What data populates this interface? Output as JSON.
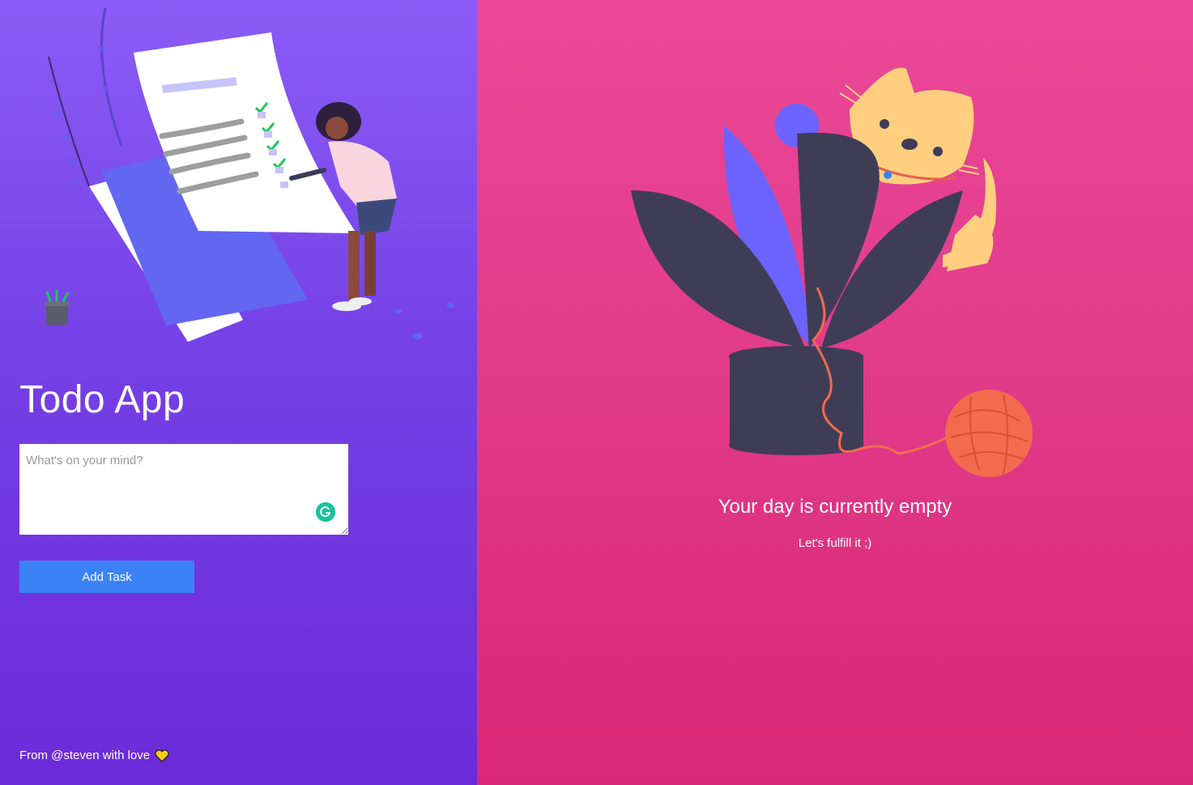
{
  "app": {
    "title": "Todo App"
  },
  "form": {
    "placeholder": "What's on your mind?",
    "value": "",
    "add_button_label": "Add Task"
  },
  "footer": {
    "text": "From @steven with love"
  },
  "empty_state": {
    "title": "Your day is currently empty",
    "subtitle": "Let's fulfill it ;)"
  },
  "colors": {
    "left_panel": "#7c3aed",
    "right_panel": "#e03a88",
    "button": "#3b82f6",
    "heart": "#facc15",
    "grammarly": "#15c39a"
  },
  "icons": [
    "grammarly-icon",
    "heart-icon"
  ]
}
